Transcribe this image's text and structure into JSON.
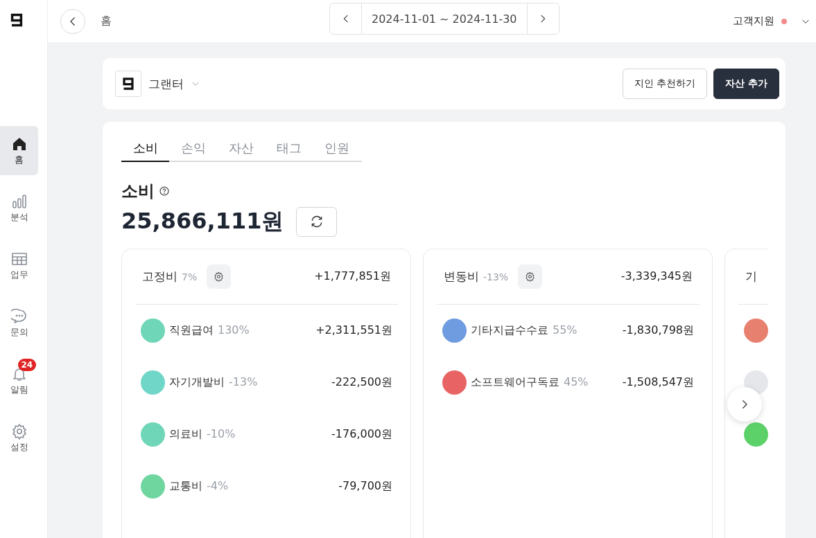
{
  "sidebar": {
    "items": [
      {
        "label": "홈",
        "kind": "home",
        "selected": true
      },
      {
        "label": "분석",
        "kind": "chart",
        "selected": false
      },
      {
        "label": "업무",
        "kind": "table",
        "selected": false
      },
      {
        "label": "문의",
        "kind": "chat",
        "selected": false
      },
      {
        "label": "알림",
        "kind": "bell",
        "selected": false,
        "badge": "24"
      },
      {
        "label": "설정",
        "kind": "gear",
        "selected": false
      }
    ]
  },
  "topbar": {
    "breadcrumb": "홈",
    "date_range": "2024-11-01 ~ 2024-11-30",
    "user": "고객지원"
  },
  "company": {
    "name": "그랜터",
    "buttons": [
      {
        "label": "지인 추천하기",
        "kind": "outline"
      },
      {
        "label": "자산 추가",
        "kind": "primary"
      }
    ]
  },
  "tabs": [
    {
      "label": "소비",
      "selected": true
    },
    {
      "label": "손익",
      "selected": false
    },
    {
      "label": "자산",
      "selected": false
    },
    {
      "label": "태그",
      "selected": false
    },
    {
      "label": "인원",
      "selected": false
    }
  ],
  "summary": {
    "title": "소비",
    "total": "25,866,111원"
  },
  "groups": [
    {
      "title": "고정비",
      "percent": "7%",
      "amount": "+1,777,851원",
      "items": [
        {
          "name": "직원급여",
          "percent": "130%",
          "amount": "+2,311,551원",
          "color": "#6fd6b8"
        },
        {
          "name": "자기개발비",
          "percent": "-13%",
          "amount": "-222,500원",
          "color": "#6fd6c8"
        },
        {
          "name": "의료비",
          "percent": "-10%",
          "amount": "-176,000원",
          "color": "#6fd6b8"
        },
        {
          "name": "교통비",
          "percent": "-4%",
          "amount": "-79,700원",
          "color": "#6fd6a0"
        }
      ]
    },
    {
      "title": "변동비",
      "percent": "-13%",
      "amount": "-3,339,345원",
      "items": [
        {
          "name": "기타지급수수료",
          "percent": "55%",
          "amount": "-1,830,798원",
          "color": "#6f9be0"
        },
        {
          "name": "소프트웨어구독료",
          "percent": "45%",
          "amount": "-1,508,547원",
          "color": "#e86464"
        }
      ]
    },
    {
      "title": "기",
      "items": [
        {
          "color": "#e8806f"
        },
        {
          "color": "#e5e7eb"
        },
        {
          "color": "#5cd16a"
        }
      ]
    }
  ]
}
